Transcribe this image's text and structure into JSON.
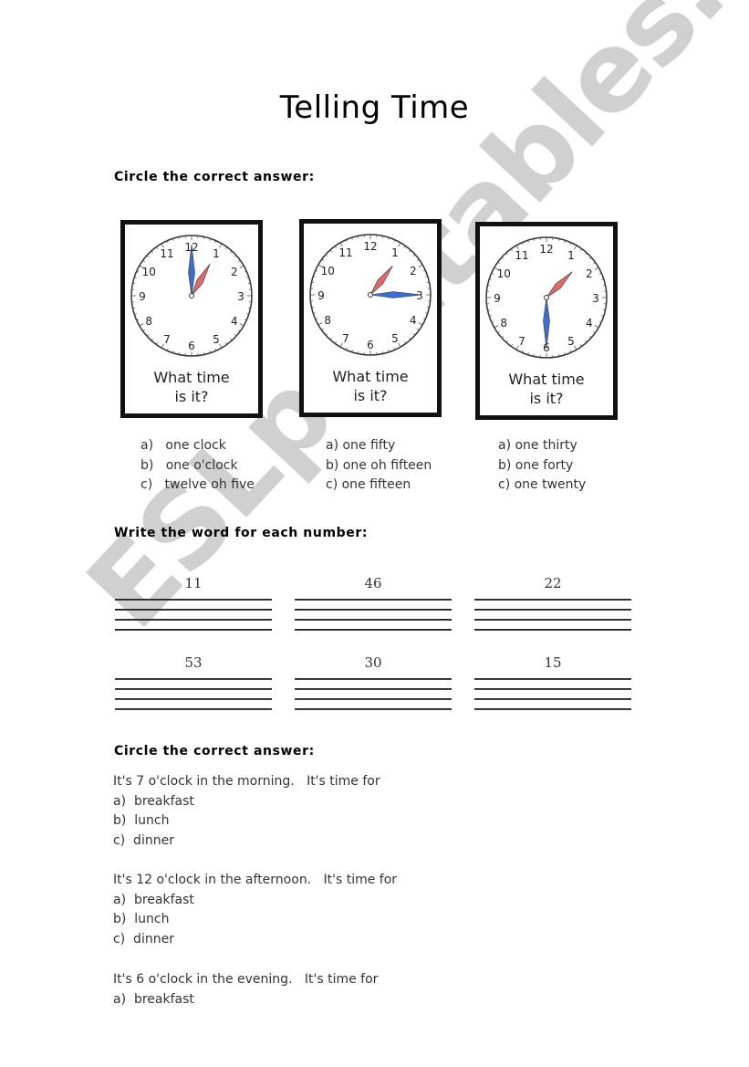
{
  "title": "Telling Time",
  "section1": {
    "heading": "Circle the correct answer:",
    "clocks": [
      {
        "caption_line1": "What time",
        "caption_line2": "is it?",
        "hour": 1,
        "minute": 0,
        "options": [
          "a)   one clock",
          "b)   one o'clock",
          "c)   twelve oh five"
        ]
      },
      {
        "caption_line1": "What time",
        "caption_line2": "is it?",
        "hour": 1,
        "minute": 15,
        "options": [
          "a) one fifty",
          "b) one oh fifteen",
          "c) one fifteen"
        ]
      },
      {
        "caption_line1": "What time",
        "caption_line2": "is it?",
        "hour": 1,
        "minute": 30,
        "options": [
          "a) one thirty",
          "b) one forty",
          "c) one twenty"
        ]
      }
    ],
    "clock_numbers": [
      "12",
      "1",
      "2",
      "3",
      "4",
      "5",
      "6",
      "7",
      "8",
      "9",
      "10",
      "11"
    ],
    "hand_colors": {
      "minute": "#3a6fd0",
      "hour": "#e06a6a"
    }
  },
  "section2": {
    "heading": "Write the word for each number:",
    "numbers": [
      "11",
      "46",
      "22",
      "53",
      "30",
      "15"
    ]
  },
  "section3": {
    "heading": "Circle the correct answer:",
    "questions": [
      {
        "prompt": "It's 7 o'clock in the morning.   It's time for",
        "options": [
          "a)  breakfast",
          "b)  lunch",
          "c)  dinner"
        ]
      },
      {
        "prompt": "It's 12 o'clock in the afternoon.   It's time for",
        "options": [
          "a)  breakfast",
          "b)  lunch",
          "c)  dinner"
        ]
      },
      {
        "prompt": "It's 6 o'clock in the evening.   It's time for",
        "options": [
          "a)  breakfast"
        ]
      }
    ]
  },
  "watermark": "ESLprintables.com"
}
